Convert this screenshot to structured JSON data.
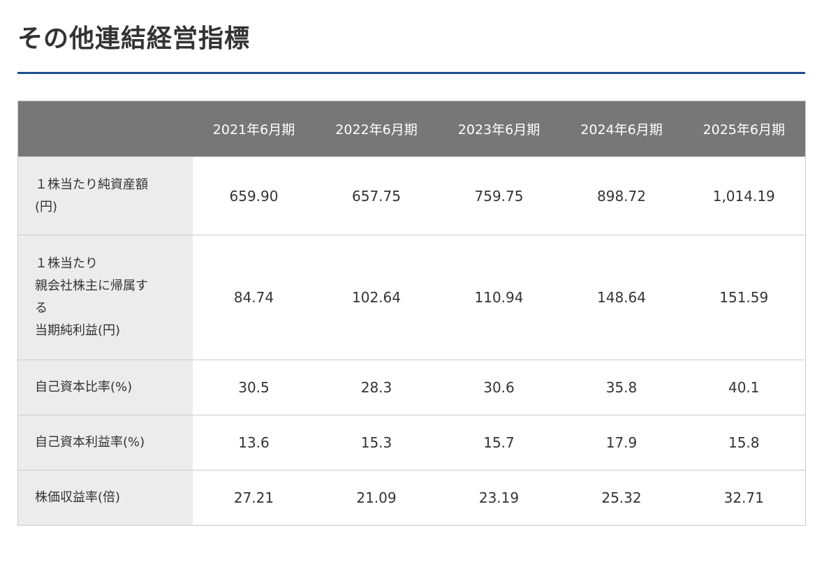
{
  "title": "その他連結経営指標",
  "colors": {
    "accent": "#1f4e8c",
    "header_bg": "#777777",
    "row_label_bg": "#ececec"
  },
  "table": {
    "columns": [
      "2021年6月期",
      "2022年6月期",
      "2023年6月期",
      "2024年6月期",
      "2025年6月期"
    ],
    "rows": [
      {
        "label": "１株当たり純資産額\n(円)",
        "values": [
          "659.90",
          "657.75",
          "759.75",
          "898.72",
          "1,014.19"
        ]
      },
      {
        "label": "１株当たり\n親会社株主に帰属す\nる\n当期純利益(円)",
        "values": [
          "84.74",
          "102.64",
          "110.94",
          "148.64",
          "151.59"
        ]
      },
      {
        "label": "自己資本比率(%)",
        "values": [
          "30.5",
          "28.3",
          "30.6",
          "35.8",
          "40.1"
        ]
      },
      {
        "label": "自己資本利益率(%)",
        "values": [
          "13.6",
          "15.3",
          "15.7",
          "17.9",
          "15.8"
        ]
      },
      {
        "label": "株価収益率(倍)",
        "values": [
          "27.21",
          "21.09",
          "23.19",
          "25.32",
          "32.71"
        ]
      }
    ]
  }
}
